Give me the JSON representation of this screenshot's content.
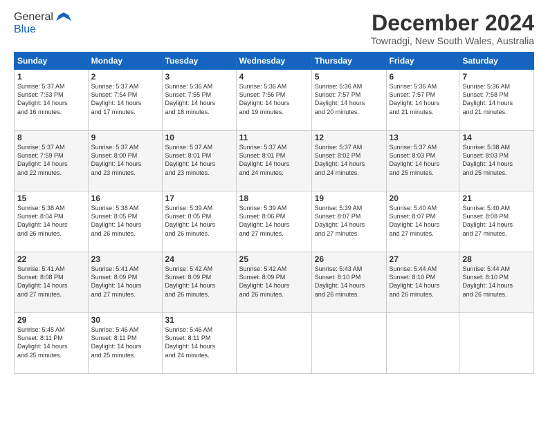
{
  "logo": {
    "general": "General",
    "blue": "Blue"
  },
  "header": {
    "month": "December 2024",
    "location": "Towradgi, New South Wales, Australia"
  },
  "weekdays": [
    "Sunday",
    "Monday",
    "Tuesday",
    "Wednesday",
    "Thursday",
    "Friday",
    "Saturday"
  ],
  "weeks": [
    [
      {
        "day": 1,
        "info": "Sunrise: 5:37 AM\nSunset: 7:53 PM\nDaylight: 14 hours\nand 16 minutes."
      },
      {
        "day": 2,
        "info": "Sunrise: 5:37 AM\nSunset: 7:54 PM\nDaylight: 14 hours\nand 17 minutes."
      },
      {
        "day": 3,
        "info": "Sunrise: 5:36 AM\nSunset: 7:55 PM\nDaylight: 14 hours\nand 18 minutes."
      },
      {
        "day": 4,
        "info": "Sunrise: 5:36 AM\nSunset: 7:56 PM\nDaylight: 14 hours\nand 19 minutes."
      },
      {
        "day": 5,
        "info": "Sunrise: 5:36 AM\nSunset: 7:57 PM\nDaylight: 14 hours\nand 20 minutes."
      },
      {
        "day": 6,
        "info": "Sunrise: 5:36 AM\nSunset: 7:57 PM\nDaylight: 14 hours\nand 21 minutes."
      },
      {
        "day": 7,
        "info": "Sunrise: 5:36 AM\nSunset: 7:58 PM\nDaylight: 14 hours\nand 21 minutes."
      }
    ],
    [
      {
        "day": 8,
        "info": "Sunrise: 5:37 AM\nSunset: 7:59 PM\nDaylight: 14 hours\nand 22 minutes."
      },
      {
        "day": 9,
        "info": "Sunrise: 5:37 AM\nSunset: 8:00 PM\nDaylight: 14 hours\nand 23 minutes."
      },
      {
        "day": 10,
        "info": "Sunrise: 5:37 AM\nSunset: 8:01 PM\nDaylight: 14 hours\nand 23 minutes."
      },
      {
        "day": 11,
        "info": "Sunrise: 5:37 AM\nSunset: 8:01 PM\nDaylight: 14 hours\nand 24 minutes."
      },
      {
        "day": 12,
        "info": "Sunrise: 5:37 AM\nSunset: 8:02 PM\nDaylight: 14 hours\nand 24 minutes."
      },
      {
        "day": 13,
        "info": "Sunrise: 5:37 AM\nSunset: 8:03 PM\nDaylight: 14 hours\nand 25 minutes."
      },
      {
        "day": 14,
        "info": "Sunrise: 5:38 AM\nSunset: 8:03 PM\nDaylight: 14 hours\nand 25 minutes."
      }
    ],
    [
      {
        "day": 15,
        "info": "Sunrise: 5:38 AM\nSunset: 8:04 PM\nDaylight: 14 hours\nand 26 minutes."
      },
      {
        "day": 16,
        "info": "Sunrise: 5:38 AM\nSunset: 8:05 PM\nDaylight: 14 hours\nand 26 minutes."
      },
      {
        "day": 17,
        "info": "Sunrise: 5:39 AM\nSunset: 8:05 PM\nDaylight: 14 hours\nand 26 minutes."
      },
      {
        "day": 18,
        "info": "Sunrise: 5:39 AM\nSunset: 8:06 PM\nDaylight: 14 hours\nand 27 minutes."
      },
      {
        "day": 19,
        "info": "Sunrise: 5:39 AM\nSunset: 8:07 PM\nDaylight: 14 hours\nand 27 minutes."
      },
      {
        "day": 20,
        "info": "Sunrise: 5:40 AM\nSunset: 8:07 PM\nDaylight: 14 hours\nand 27 minutes."
      },
      {
        "day": 21,
        "info": "Sunrise: 5:40 AM\nSunset: 8:08 PM\nDaylight: 14 hours\nand 27 minutes."
      }
    ],
    [
      {
        "day": 22,
        "info": "Sunrise: 5:41 AM\nSunset: 8:08 PM\nDaylight: 14 hours\nand 27 minutes."
      },
      {
        "day": 23,
        "info": "Sunrise: 5:41 AM\nSunset: 8:09 PM\nDaylight: 14 hours\nand 27 minutes."
      },
      {
        "day": 24,
        "info": "Sunrise: 5:42 AM\nSunset: 8:09 PM\nDaylight: 14 hours\nand 26 minutes."
      },
      {
        "day": 25,
        "info": "Sunrise: 5:42 AM\nSunset: 8:09 PM\nDaylight: 14 hours\nand 26 minutes."
      },
      {
        "day": 26,
        "info": "Sunrise: 5:43 AM\nSunset: 8:10 PM\nDaylight: 14 hours\nand 26 minutes."
      },
      {
        "day": 27,
        "info": "Sunrise: 5:44 AM\nSunset: 8:10 PM\nDaylight: 14 hours\nand 26 minutes."
      },
      {
        "day": 28,
        "info": "Sunrise: 5:44 AM\nSunset: 8:10 PM\nDaylight: 14 hours\nand 26 minutes."
      }
    ],
    [
      {
        "day": 29,
        "info": "Sunrise: 5:45 AM\nSunset: 8:11 PM\nDaylight: 14 hours\nand 25 minutes."
      },
      {
        "day": 30,
        "info": "Sunrise: 5:46 AM\nSunset: 8:11 PM\nDaylight: 14 hours\nand 25 minutes."
      },
      {
        "day": 31,
        "info": "Sunrise: 5:46 AM\nSunset: 8:11 PM\nDaylight: 14 hours\nand 24 minutes."
      },
      null,
      null,
      null,
      null
    ]
  ]
}
